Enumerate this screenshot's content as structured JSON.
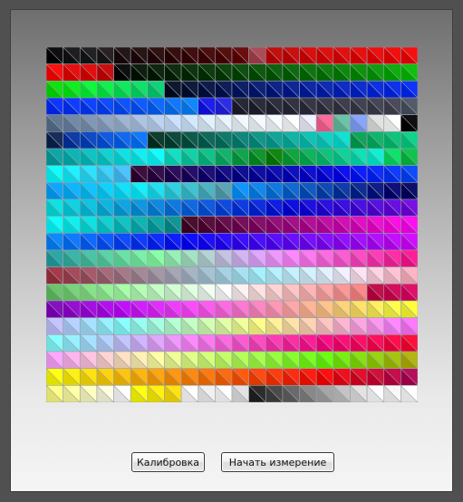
{
  "buttons": {
    "calibrate_label": "Калибровка",
    "start_label": "Начать измерение"
  },
  "grid": {
    "columns": 22,
    "rows": 21,
    "line_color": "#9aa0a8",
    "cells": [
      [
        "#000000",
        "#101010",
        "#141414",
        "#1a1414",
        "#160808",
        "#1c0606",
        "#220404",
        "#2a0000",
        "#350000",
        "#400000",
        "#4a0000",
        "#600000",
        "#a8404c",
        "#c00000",
        "#c80000",
        "#d40000",
        "#dc0000",
        "#e20000",
        "#e80000",
        "#ee0000",
        "#f20000",
        "#f60000"
      ],
      [
        "#ff0000",
        "#e80000",
        "#e00000",
        "#c80000",
        "#000000",
        "#001000",
        "#001800",
        "#002000",
        "#002800",
        "#003000",
        "#003a00",
        "#004400",
        "#004e00",
        "#005800",
        "#006200",
        "#006c00",
        "#007600",
        "#008000",
        "#008c00",
        "#009800",
        "#00a800",
        "#00bc00"
      ],
      [
        "#00e000",
        "#00ee10",
        "#00f830",
        "#00f040",
        "#00e850",
        "#00e060",
        "#00d070",
        "#000a20",
        "#000c30",
        "#000e40",
        "#001050",
        "#001260",
        "#001470",
        "#001680",
        "#001890",
        "#001aa0",
        "#001cb0",
        "#001ec0",
        "#0020d0",
        "#0022e0",
        "#0024ec",
        "#0026f8"
      ],
      [
        "#0028ff",
        "#0030ff",
        "#0038ff",
        "#0040ff",
        "#0048ff",
        "#0050ff",
        "#0060ff",
        "#0070ff",
        "#0080ff",
        "#1010f0",
        "#2020e8",
        "#1a1a2a",
        "#1e1e2e",
        "#222232",
        "#262636",
        "#2a2a3a",
        "#2e2e3e",
        "#323242",
        "#363646",
        "#3a3a4a",
        "#404050",
        "#485060"
      ],
      [
        "#58708c",
        "#6880a0",
        "#7890b0",
        "#88a0c0",
        "#98b0d0",
        "#a8c0e0",
        "#b8d0f0",
        "#c8e0ff",
        "#d0e8ff",
        "#e0f0ff",
        "#e8f4ff",
        "#f0f8ff",
        "#f4faff",
        "#f8fcff",
        "#ffffff",
        "#f0f0ff",
        "#ff6090",
        "#60c0a0",
        "#80a0ff",
        "#e0e0e0",
        "#ffffff",
        "#000000"
      ],
      [
        "#0a2050",
        "#0030a0",
        "#0040c0",
        "#0050e0",
        "#0060f0",
        "#0070ff",
        "#003020",
        "#004030",
        "#005040",
        "#006050",
        "#007060",
        "#008070",
        "#009080",
        "#00a090",
        "#00b0a0",
        "#00c0b0",
        "#00d0c0",
        "#00e0d0",
        "#00a050",
        "#00b060",
        "#00c070",
        "#00d080"
      ],
      [
        "#00a0a0",
        "#00b0b0",
        "#00c0c0",
        "#00d0d0",
        "#00e0e0",
        "#00f0f0",
        "#00ffff",
        "#00e0c0",
        "#00d0a0",
        "#00c080",
        "#00b060",
        "#00a040",
        "#009020",
        "#008000",
        "#00a030",
        "#00b050",
        "#00c070",
        "#00d090",
        "#00e0b0",
        "#00f0d0",
        "#00e060",
        "#00c040"
      ],
      [
        "#00ffff",
        "#10f0ff",
        "#20e0ff",
        "#30d0ff",
        "#40c0ff",
        "#300030",
        "#280040",
        "#200050",
        "#180060",
        "#100070",
        "#080080",
        "#000090",
        "#0000a0",
        "#0000b0",
        "#0000c0",
        "#0000d0",
        "#0000e0",
        "#0000f0",
        "#0010ff",
        "#0020ff",
        "#0030ff",
        "#0040ff"
      ],
      [
        "#00a0ff",
        "#00b0ff",
        "#00c0ff",
        "#00d0ff",
        "#00e0ff",
        "#00f0ff",
        "#10e0f0",
        "#20d0e0",
        "#30c0d0",
        "#40b0c0",
        "#50a0b0",
        "#0090ff",
        "#0080f0",
        "#0070e0",
        "#0060d0",
        "#0050c0",
        "#0040b0",
        "#0030a0",
        "#002090",
        "#001080",
        "#000070",
        "#000060"
      ],
      [
        "#00e0e0",
        "#00d0e0",
        "#00c0e0",
        "#00b0e0",
        "#00a0e0",
        "#0090e0",
        "#0080e0",
        "#0070e0",
        "#0060e0",
        "#0050e0",
        "#0040e0",
        "#0030e0",
        "#0020e0",
        "#0010e0",
        "#0000e0",
        "#1000e0",
        "#2000e0",
        "#3000e0",
        "#4000e0",
        "#5000e0",
        "#6000e0",
        "#7000e0"
      ],
      [
        "#00ffff",
        "#00f0f0",
        "#00e0e0",
        "#00d0d0",
        "#00c0c0",
        "#00b0b0",
        "#00a0a0",
        "#009090",
        "#400020",
        "#500030",
        "#600040",
        "#700050",
        "#800060",
        "#900070",
        "#a00080",
        "#b00090",
        "#c000a0",
        "#d000b0",
        "#e000c0",
        "#f000d0",
        "#ff00e0",
        "#ff00f0"
      ],
      [
        "#0080ff",
        "#0070ff",
        "#0060ff",
        "#0050ff",
        "#0040ff",
        "#0030ff",
        "#0020ff",
        "#0010ff",
        "#0000ff",
        "#1000ff",
        "#2000ff",
        "#3000ff",
        "#4000ff",
        "#5000ff",
        "#6000ff",
        "#7000ff",
        "#8000ff",
        "#9000ff",
        "#a000ff",
        "#b000ff",
        "#c000ff",
        "#d000ff"
      ],
      [
        "#20a0a0",
        "#30b0a0",
        "#40c0a0",
        "#50d0a0",
        "#60e0a0",
        "#70f0a0",
        "#80ffa0",
        "#90f0b0",
        "#a0e0c0",
        "#b0d0d0",
        "#c0c0e0",
        "#d0b0f0",
        "#e0a0ff",
        "#f090ff",
        "#ff80ff",
        "#ff70f0",
        "#ff60e0",
        "#ff50d0",
        "#ff40c0",
        "#ff30b0",
        "#ff20a0",
        "#ff1090"
      ],
      [
        "#a03040",
        "#a04050",
        "#a05060",
        "#a06070",
        "#a07080",
        "#a08090",
        "#a090a0",
        "#a0a0b0",
        "#a0b0c0",
        "#a0c0d0",
        "#a0d0e0",
        "#a0e0f0",
        "#a0f0ff",
        "#b0f0ff",
        "#c0f0ff",
        "#d0f0ff",
        "#e0f0ff",
        "#f0f0ff",
        "#ffe0f0",
        "#ffd0e0",
        "#ffc0d0",
        "#ffb0c0"
      ],
      [
        "#60c060",
        "#70d070",
        "#80e080",
        "#90f090",
        "#a0ffa0",
        "#b0ffb0",
        "#c0ffc0",
        "#d0ffd0",
        "#e0ffe0",
        "#f0fff0",
        "#ffffff",
        "#fff0f0",
        "#ffe0e0",
        "#ffd0d0",
        "#ffc0c0",
        "#ffb0b0",
        "#ffa0a0",
        "#ff9090",
        "#ff8080",
        "#c00040",
        "#d00050",
        "#e00060"
      ],
      [
        "#8000c0",
        "#9000d0",
        "#a000e0",
        "#b000f0",
        "#c000ff",
        "#d010ff",
        "#e020ff",
        "#f030ff",
        "#ff40ff",
        "#ff50f0",
        "#ff60e0",
        "#ff70d0",
        "#ff80c0",
        "#ff90b0",
        "#ffa0a0",
        "#ffb090",
        "#ffc080",
        "#ffd070",
        "#ffe060",
        "#fff050",
        "#ffff40",
        "#ffff30"
      ],
      [
        "#c0c0ff",
        "#b0d0ff",
        "#a0e0ff",
        "#90f0ff",
        "#80ffff",
        "#90fff0",
        "#a0ffe0",
        "#b0ffd0",
        "#c0ffc0",
        "#d0ffb0",
        "#e0ffa0",
        "#f0ff90",
        "#ffff80",
        "#fff090",
        "#ffe0a0",
        "#ffd0b0",
        "#ffc0c0",
        "#ffb0d0",
        "#ffa0e0",
        "#ff90f0",
        "#ff80ff",
        "#ff70ff"
      ],
      [
        "#80ffff",
        "#90f0ff",
        "#a0e0ff",
        "#b0d0ff",
        "#c0c0ff",
        "#d0b0ff",
        "#e0a0ff",
        "#f090ff",
        "#ff80ff",
        "#ff70f0",
        "#ff60e0",
        "#ff50d0",
        "#ff40c0",
        "#ff30b0",
        "#ff20a0",
        "#ff1090",
        "#ff0080",
        "#ff0070",
        "#ff0060",
        "#ff0050",
        "#ff0040",
        "#ff0030"
      ],
      [
        "#ffa0ff",
        "#ffb0f0",
        "#ffc0e0",
        "#ffd0d0",
        "#ffe0c0",
        "#fff0b0",
        "#ffffa0",
        "#f0ff90",
        "#e0ff80",
        "#d0ff70",
        "#c0ff60",
        "#b0ff50",
        "#a0ff40",
        "#90ff30",
        "#80ff20",
        "#70ff10",
        "#60ff00",
        "#70f000",
        "#80e000",
        "#90d000",
        "#a0c000",
        "#b0b000"
      ],
      [
        "#ffff00",
        "#fff000",
        "#ffe000",
        "#ffd000",
        "#ffc000",
        "#ffb000",
        "#ffa000",
        "#ff9000",
        "#ff8000",
        "#ff7000",
        "#ff6000",
        "#ff5000",
        "#ff4000",
        "#ff3000",
        "#ff2000",
        "#ff1000",
        "#ff0000",
        "#f00010",
        "#e00020",
        "#d00030",
        "#c00040",
        "#b00050"
      ],
      [
        "#ffff80",
        "#ffffa0",
        "#ffffc0",
        "#ffffe0",
        "#ffffff",
        "#ffff00",
        "#fff000",
        "#ffe000",
        "#ffffff",
        "#f0f0f0",
        "#ffffff",
        "#e0e0e0",
        "#202020",
        "#404040",
        "#606060",
        "#808080",
        "#a0a0a0",
        "#c0c0c0",
        "#e0e0e0",
        "#ffffff",
        "#f8f8f8",
        "#ffffff"
      ]
    ]
  }
}
